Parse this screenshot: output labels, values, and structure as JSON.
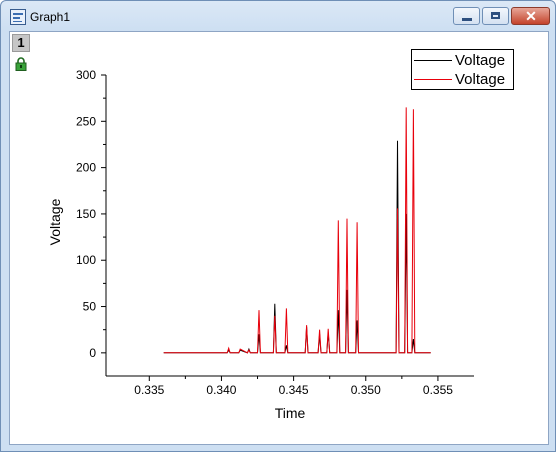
{
  "window": {
    "title": "Graph1",
    "layer_tab": "1",
    "icons": [
      "graph-window-icon",
      "minimize-icon",
      "maximize-icon",
      "close-icon",
      "lock-icon"
    ]
  },
  "chart_data": {
    "type": "line",
    "xlabel": "Time",
    "ylabel": "Voltage",
    "xlim": [
      0.332,
      0.3575
    ],
    "ylim": [
      -25,
      300
    ],
    "xticks": [
      "0.335",
      "0.340",
      "0.345",
      "0.350",
      "0.355"
    ],
    "yticks": [
      "0",
      "50",
      "100",
      "150",
      "200",
      "250",
      "300"
    ],
    "legend_position": "top-right",
    "grid": false,
    "series": [
      {
        "name": "Voltage",
        "color": "#000000",
        "x": [
          0.336,
          0.3404,
          0.3405,
          0.3406,
          0.3412,
          0.3413,
          0.3418,
          0.3419,
          0.342,
          0.3425,
          0.3426,
          0.3427,
          0.3436,
          0.3437,
          0.3438,
          0.3444,
          0.3445,
          0.3446,
          0.3458,
          0.3459,
          0.346,
          0.3467,
          0.3468,
          0.3469,
          0.3473,
          0.3474,
          0.3475,
          0.348,
          0.3481,
          0.3482,
          0.3486,
          0.3487,
          0.3488,
          0.3493,
          0.3494,
          0.3495,
          0.3521,
          0.3522,
          0.3523,
          0.3527,
          0.3528,
          0.3529,
          0.3532,
          0.3533,
          0.3534,
          0.3545
        ],
        "y": [
          0,
          0,
          3,
          0,
          0,
          3,
          0,
          4,
          0,
          0,
          20,
          0,
          0,
          53,
          0,
          0,
          8,
          0,
          0,
          28,
          0,
          0,
          20,
          0,
          0,
          22,
          0,
          0,
          46,
          0,
          0,
          68,
          0,
          0,
          35,
          0,
          0,
          229,
          0,
          0,
          150,
          0,
          0,
          15,
          0,
          0
        ]
      },
      {
        "name": "Voltage",
        "color": "#e8000b",
        "x": [
          0.336,
          0.3404,
          0.3405,
          0.3406,
          0.3412,
          0.3413,
          0.3418,
          0.3419,
          0.342,
          0.3425,
          0.3426,
          0.3427,
          0.3436,
          0.3437,
          0.3438,
          0.3444,
          0.3445,
          0.3446,
          0.3458,
          0.3459,
          0.346,
          0.3467,
          0.3468,
          0.3469,
          0.3473,
          0.3474,
          0.3475,
          0.348,
          0.3481,
          0.3482,
          0.3486,
          0.3487,
          0.3488,
          0.3493,
          0.3494,
          0.3495,
          0.3521,
          0.3522,
          0.3523,
          0.3527,
          0.3528,
          0.3529,
          0.3532,
          0.3533,
          0.3534,
          0.3545
        ],
        "y": [
          0,
          0,
          5,
          0,
          0,
          4,
          0,
          3,
          0,
          0,
          46,
          0,
          0,
          40,
          0,
          0,
          48,
          0,
          0,
          30,
          0,
          0,
          25,
          0,
          0,
          26,
          0,
          0,
          143,
          0,
          0,
          145,
          0,
          0,
          141,
          0,
          0,
          156,
          0,
          0,
          265,
          0,
          0,
          263,
          0,
          0
        ]
      }
    ]
  }
}
